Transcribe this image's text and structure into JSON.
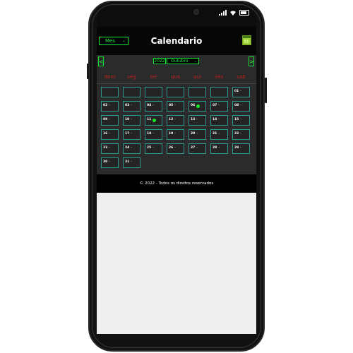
{
  "header": {
    "title": "Calendario",
    "mode_select": "Mes",
    "calendar_icon": "calendar-icon"
  },
  "nav": {
    "prev_label": "<",
    "next_label": ">",
    "year": "2022",
    "month": "Outubro"
  },
  "weekdays": [
    "dom",
    "seg",
    "ter",
    "qua",
    "qui",
    "sex",
    "sab"
  ],
  "weeks": [
    [
      {
        "num": "",
        "dash": ""
      },
      {
        "num": "",
        "dash": ""
      },
      {
        "num": "",
        "dash": ""
      },
      {
        "num": "",
        "dash": ""
      },
      {
        "num": "",
        "dash": ""
      },
      {
        "num": "",
        "dash": ""
      },
      {
        "num": "01",
        "dash": "–"
      }
    ],
    [
      {
        "num": "02",
        "dash": "–"
      },
      {
        "num": "03",
        "dash": "–"
      },
      {
        "num": "04",
        "dash": "–"
      },
      {
        "num": "05",
        "dash": "–"
      },
      {
        "num": "06",
        "dash": "",
        "dot": true
      },
      {
        "num": "07",
        "dash": "–"
      },
      {
        "num": "08",
        "dash": "–"
      }
    ],
    [
      {
        "num": "09",
        "dash": "–"
      },
      {
        "num": "10",
        "dash": "–"
      },
      {
        "num": "11",
        "dash": "",
        "dot": true
      },
      {
        "num": "12",
        "dash": "–"
      },
      {
        "num": "13",
        "dash": "–"
      },
      {
        "num": "14",
        "dash": "–"
      },
      {
        "num": "15",
        "dash": "–"
      }
    ],
    [
      {
        "num": "16",
        "dash": "–"
      },
      {
        "num": "17",
        "dash": "–"
      },
      {
        "num": "18",
        "dash": "–"
      },
      {
        "num": "19",
        "dash": "–"
      },
      {
        "num": "20",
        "dash": "–"
      },
      {
        "num": "21",
        "dash": "–"
      },
      {
        "num": "22",
        "dash": "–"
      }
    ],
    [
      {
        "num": "23",
        "dash": "–"
      },
      {
        "num": "24",
        "dash": "–"
      },
      {
        "num": "25",
        "dash": "–"
      },
      {
        "num": "26",
        "dash": "–"
      },
      {
        "num": "27",
        "dash": "–"
      },
      {
        "num": "28",
        "dash": "–"
      },
      {
        "num": "29",
        "dash": "–"
      }
    ],
    [
      {
        "num": "30",
        "dash": "–"
      },
      {
        "num": "31",
        "dash": "–"
      }
    ]
  ],
  "footer": {
    "text": "© 2022 - Todos os direitos reservados"
  },
  "colors": {
    "accent_green": "#22ee44",
    "weekday_red": "#c42020",
    "cell_border": "#2a9a8a"
  }
}
